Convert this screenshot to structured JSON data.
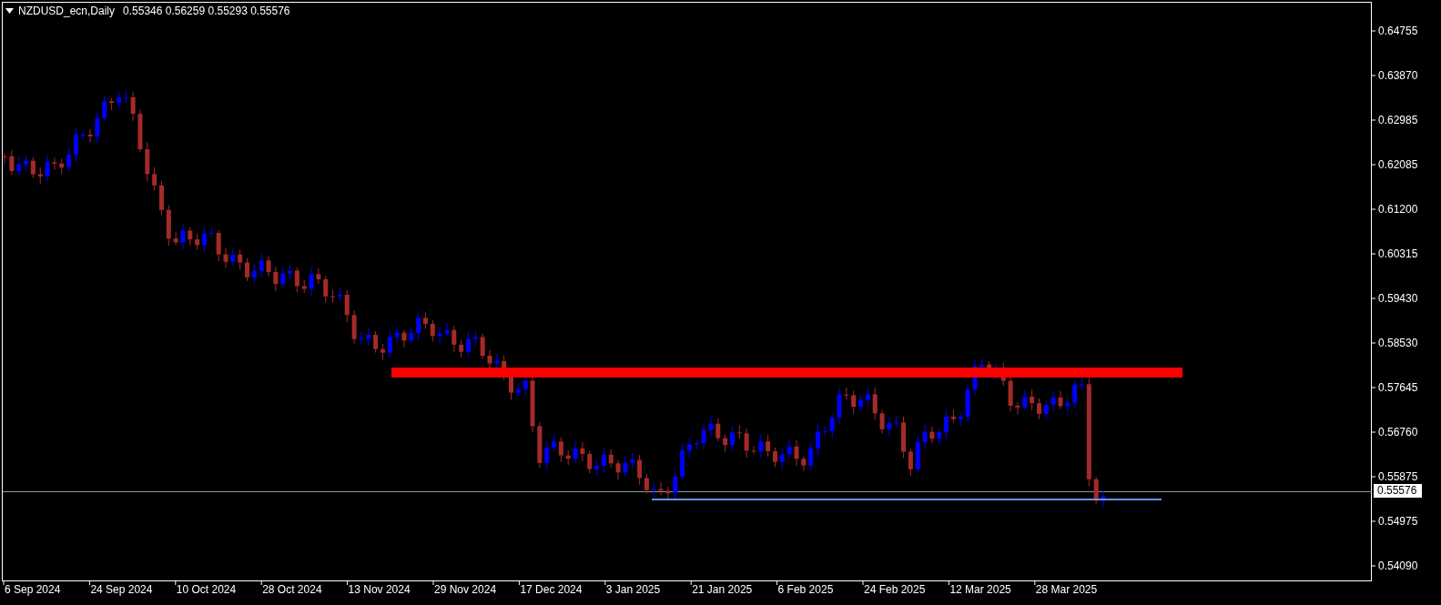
{
  "chart_header": {
    "symbol": "NZDUSD_ecn,Daily",
    "ohlc": "0.55346 0.56259 0.55293 0.55576"
  },
  "price_axis": [
    "0.64755",
    "0.63870",
    "0.62985",
    "0.62085",
    "0.61200",
    "0.60315",
    "0.59430",
    "0.58530",
    "0.57645",
    "0.56760",
    "0.55875",
    "0.54975",
    "0.54090"
  ],
  "current_price": "0.55576",
  "time_axis": [
    "6 Sep 2024",
    "24 Sep 2024",
    "10 Oct 2024",
    "28 Oct 2024",
    "13 Nov 2024",
    "29 Nov 2024",
    "17 Dec 2024",
    "3 Jan 2025",
    "21 Jan 2025",
    "6 Feb 2025",
    "24 Feb 2025",
    "12 Mar 2025",
    "28 Mar 2025"
  ]
}
